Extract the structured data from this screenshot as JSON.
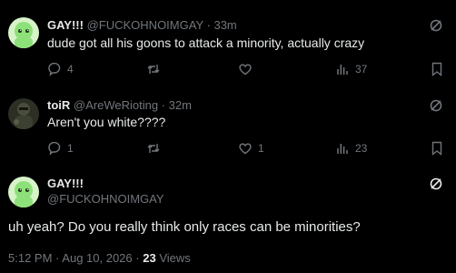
{
  "reply1": {
    "name": "GAY!!!",
    "handle": "@FUCKOHNOIMGAY",
    "separator": "·",
    "time": "33m",
    "text": "dude got all his goons to attack a minority, actually crazy",
    "replies": "4",
    "retweets": "",
    "likes": "",
    "views": "37"
  },
  "reply2": {
    "name": "toiR",
    "handle": "@AreWeRioting",
    "separator": "·",
    "time": "32m",
    "text": "Aren't you white????",
    "replies": "1",
    "retweets": "",
    "likes": "1",
    "views": "23"
  },
  "main": {
    "name": "GAY!!!",
    "handle": "@FUCKOHNOIMGAY",
    "text": "uh yeah? Do you really think only races can be minorities?",
    "time": "5:12 PM",
    "separator1": "·",
    "date": "Aug 10, 2026",
    "separator2": "·",
    "views_count": "23",
    "views_label": "Views"
  },
  "colors": {
    "background": "#000000",
    "text": "#e7e9ea",
    "muted": "#71767b",
    "avatar_green": "#8ee07a"
  },
  "icons": [
    "reply-icon",
    "retweet-icon",
    "like-icon",
    "views-icon",
    "bookmark-icon",
    "grok-icon"
  ]
}
